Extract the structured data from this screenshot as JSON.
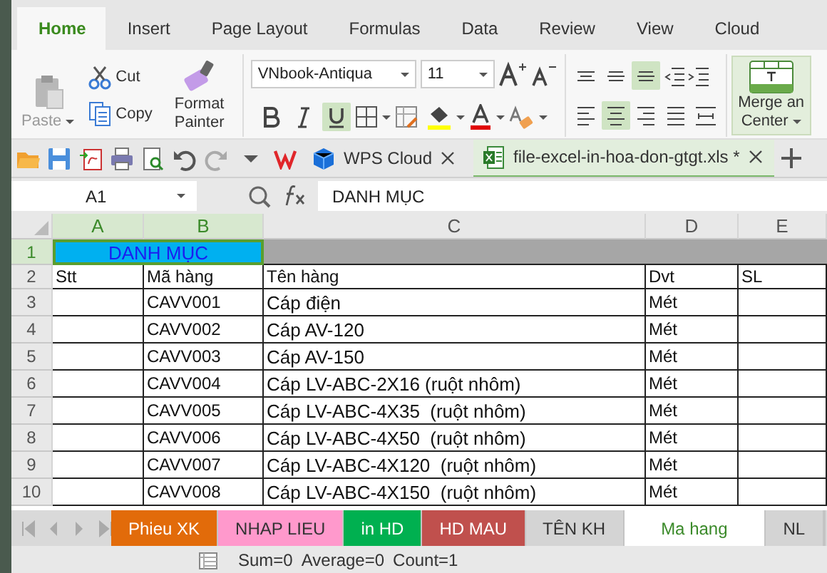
{
  "menu_tabs": [
    {
      "label": "Home",
      "selected": true
    },
    {
      "label": "Insert",
      "selected": false
    },
    {
      "label": "Page Layout",
      "selected": false
    },
    {
      "label": "Formulas",
      "selected": false
    },
    {
      "label": "Data",
      "selected": false
    },
    {
      "label": "Review",
      "selected": false
    },
    {
      "label": "View",
      "selected": false
    },
    {
      "label": "Cloud",
      "selected": false
    }
  ],
  "ribbon": {
    "paste": {
      "label": "Paste",
      "disabled": true
    },
    "cut": "Cut",
    "copy": "Copy",
    "format_painter": "Format Painter",
    "font": {
      "name": "VNbook-Antiqua",
      "size": "11",
      "bold": false,
      "italic": false,
      "underline": true
    },
    "vertical_align": [
      {
        "kind": "top",
        "selected": false
      },
      {
        "kind": "middle",
        "selected": false
      },
      {
        "kind": "bottom",
        "selected": true
      }
    ],
    "horizontal_align": [
      {
        "kind": "left",
        "selected": false
      },
      {
        "kind": "center",
        "selected": true
      },
      {
        "kind": "right",
        "selected": false
      },
      {
        "kind": "justify",
        "selected": false
      },
      {
        "kind": "distributed",
        "selected": false
      }
    ],
    "merge": {
      "line_1": "Merge an",
      "line_2": "Center",
      "selected": true
    }
  },
  "doc_tabs": [
    {
      "label": "WPS Cloud",
      "kind": "cloud",
      "selected": false
    },
    {
      "label": "file-excel-in-hoa-don-gtgt.xls *",
      "kind": "workbook",
      "selected": true
    }
  ],
  "formula_bar": {
    "cell": "A1",
    "formula": "DANH MỤC"
  },
  "sheet": {
    "columns": [
      {
        "label": "A",
        "selected": true
      },
      {
        "label": "B",
        "selected": true
      },
      {
        "label": "C",
        "selected": false
      },
      {
        "label": "D",
        "selected": false
      },
      {
        "label": "E",
        "selected": false
      }
    ],
    "rows": [
      {
        "number": "1",
        "selected": true,
        "kind": "title",
        "title": "DANH MỤC"
      },
      {
        "number": "2",
        "selected": false,
        "kind": "data",
        "stt": "Stt",
        "code": "Mã hàng",
        "name": "Tên hàng",
        "unit": "Dvt",
        "qty": "SL"
      },
      {
        "number": "3",
        "selected": false,
        "kind": "data",
        "code": "CAVV001",
        "name": "Cáp điện",
        "unit": "Mét"
      },
      {
        "number": "4",
        "selected": false,
        "kind": "data",
        "code": "CAVV002",
        "name": "Cáp AV-120",
        "unit": "Mét"
      },
      {
        "number": "5",
        "selected": false,
        "kind": "data",
        "code": "CAVV003",
        "name": "Cáp AV-150",
        "unit": "Mét"
      },
      {
        "number": "6",
        "selected": false,
        "kind": "data",
        "code": "CAVV004",
        "name": "Cáp LV-ABC-2X16 (ruột nhôm)",
        "unit": "Mét"
      },
      {
        "number": "7",
        "selected": false,
        "kind": "data",
        "code": "CAVV005",
        "name": "Cáp LV-ABC-4X35  (ruột nhôm)",
        "unit": "Mét"
      },
      {
        "number": "8",
        "selected": false,
        "kind": "data",
        "code": "CAVV006",
        "name": "Cáp LV-ABC-4X50  (ruột nhôm)",
        "unit": "Mét"
      },
      {
        "number": "9",
        "selected": false,
        "kind": "data",
        "code": "CAVV007",
        "name": "Cáp LV-ABC-4X120  (ruột nhôm)",
        "unit": "Mét"
      },
      {
        "number": "10",
        "selected": false,
        "kind": "data",
        "code": "CAVV008",
        "name": "Cáp LV-ABC-4X150  (ruột nhôm)",
        "unit": "Mét"
      }
    ]
  },
  "sheet_tabs": [
    {
      "label": "Phieu XK",
      "color": "#e26b0a",
      "selected": false
    },
    {
      "label": "NHAP LIEU",
      "color": "#ff99cc",
      "selected": false
    },
    {
      "label": "in HD",
      "color": "#00b050",
      "selected": false
    },
    {
      "label": "HD MAU",
      "color": "#c0504d",
      "selected": false
    },
    {
      "label": "TÊN KH",
      "color": "#d4d4d4",
      "selected": false
    },
    {
      "label": "Ma hang",
      "color": "#ffffff",
      "selected": true
    },
    {
      "label": "NL",
      "color": "#d4d4d4",
      "selected": false
    }
  ],
  "status_bar": [
    "Sum=0",
    "Average=0",
    "Count=1"
  ]
}
